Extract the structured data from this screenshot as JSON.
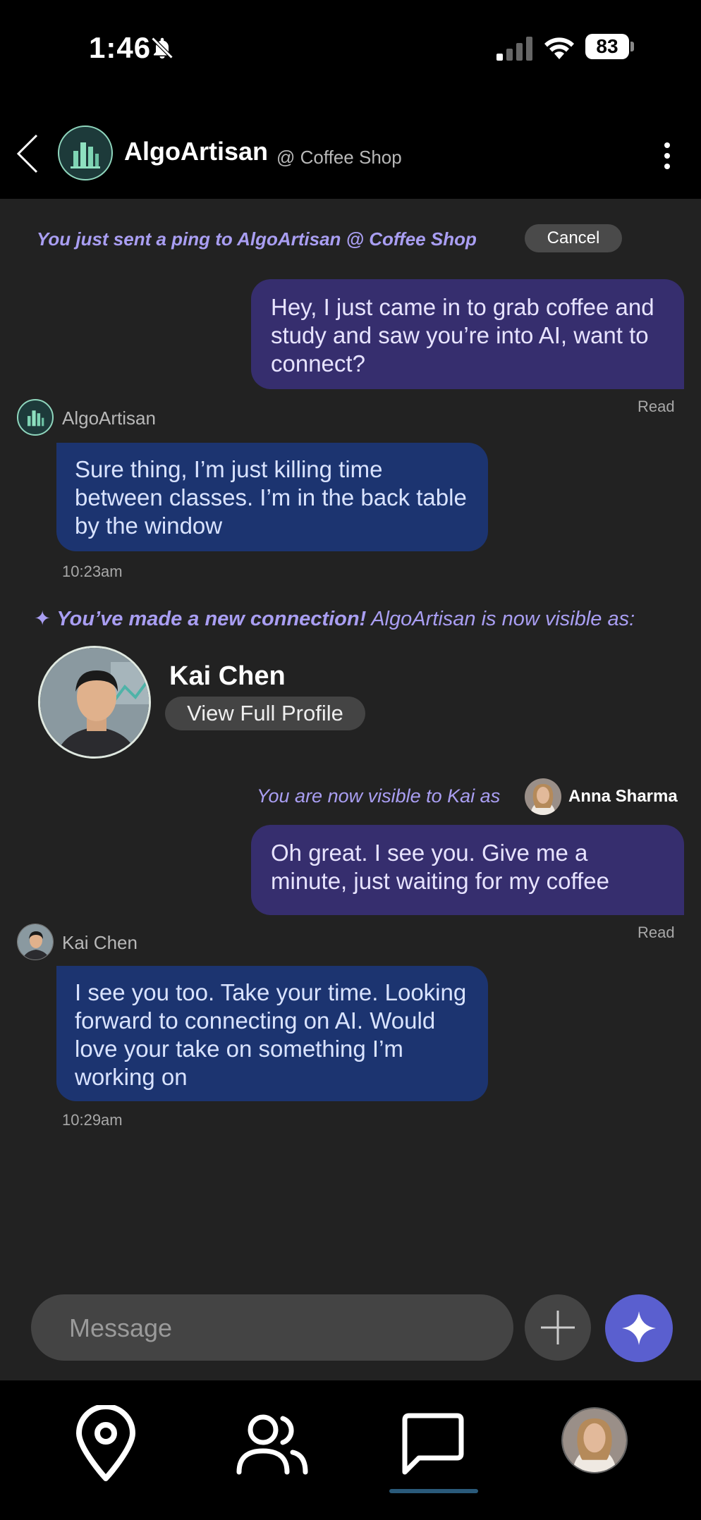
{
  "status_bar": {
    "time": "1:46",
    "battery": "83"
  },
  "header": {
    "title": "AlgoArtisan",
    "location": "@ Coffee Shop"
  },
  "ping": {
    "text": "You just sent a ping to AlgoArtisan @ Coffee Shop",
    "cancel_label": "Cancel"
  },
  "messages": [
    {
      "direction": "out",
      "text": "Hey, I just came in to grab coffee and study and saw you’re into AI, want to connect?",
      "status": "Read"
    },
    {
      "direction": "in",
      "sender": "AlgoArtisan",
      "text": "Sure thing, I’m just killing time between classes. I’m in the back table by the window",
      "time": "10:23am"
    },
    {
      "direction": "out",
      "text": "Oh great. I see you. Give me a minute, just waiting for my coffee",
      "status": "Read"
    },
    {
      "direction": "in",
      "sender": "Kai Chen",
      "text": "I see you too. Take your time. Looking forward to connecting on AI. Would love your take on something I’m working on",
      "time": "10:29am"
    }
  ],
  "connection": {
    "star": "✦",
    "highlight": "You’ve made a new connection!",
    "rest": " AlgoArtisan is now visible as:",
    "name": "Kai Chen",
    "view_profile_label": "View Full Profile"
  },
  "visibility": {
    "text": "You are now visible to Kai as",
    "self_name": "Anna Sharma"
  },
  "composer": {
    "placeholder": "Message"
  },
  "tabs": [
    {
      "name": "map",
      "icon": "map-pin-icon"
    },
    {
      "name": "people",
      "icon": "people-icon"
    },
    {
      "name": "messages",
      "icon": "chat-bubble-icon",
      "active": true
    },
    {
      "name": "profile",
      "icon": "avatar"
    }
  ],
  "colors": {
    "accent": "#a99ef2",
    "outgoing_bubble": "#362e6e",
    "incoming_bubble": "#1c3470",
    "ai_button": "#5a5fcf"
  }
}
